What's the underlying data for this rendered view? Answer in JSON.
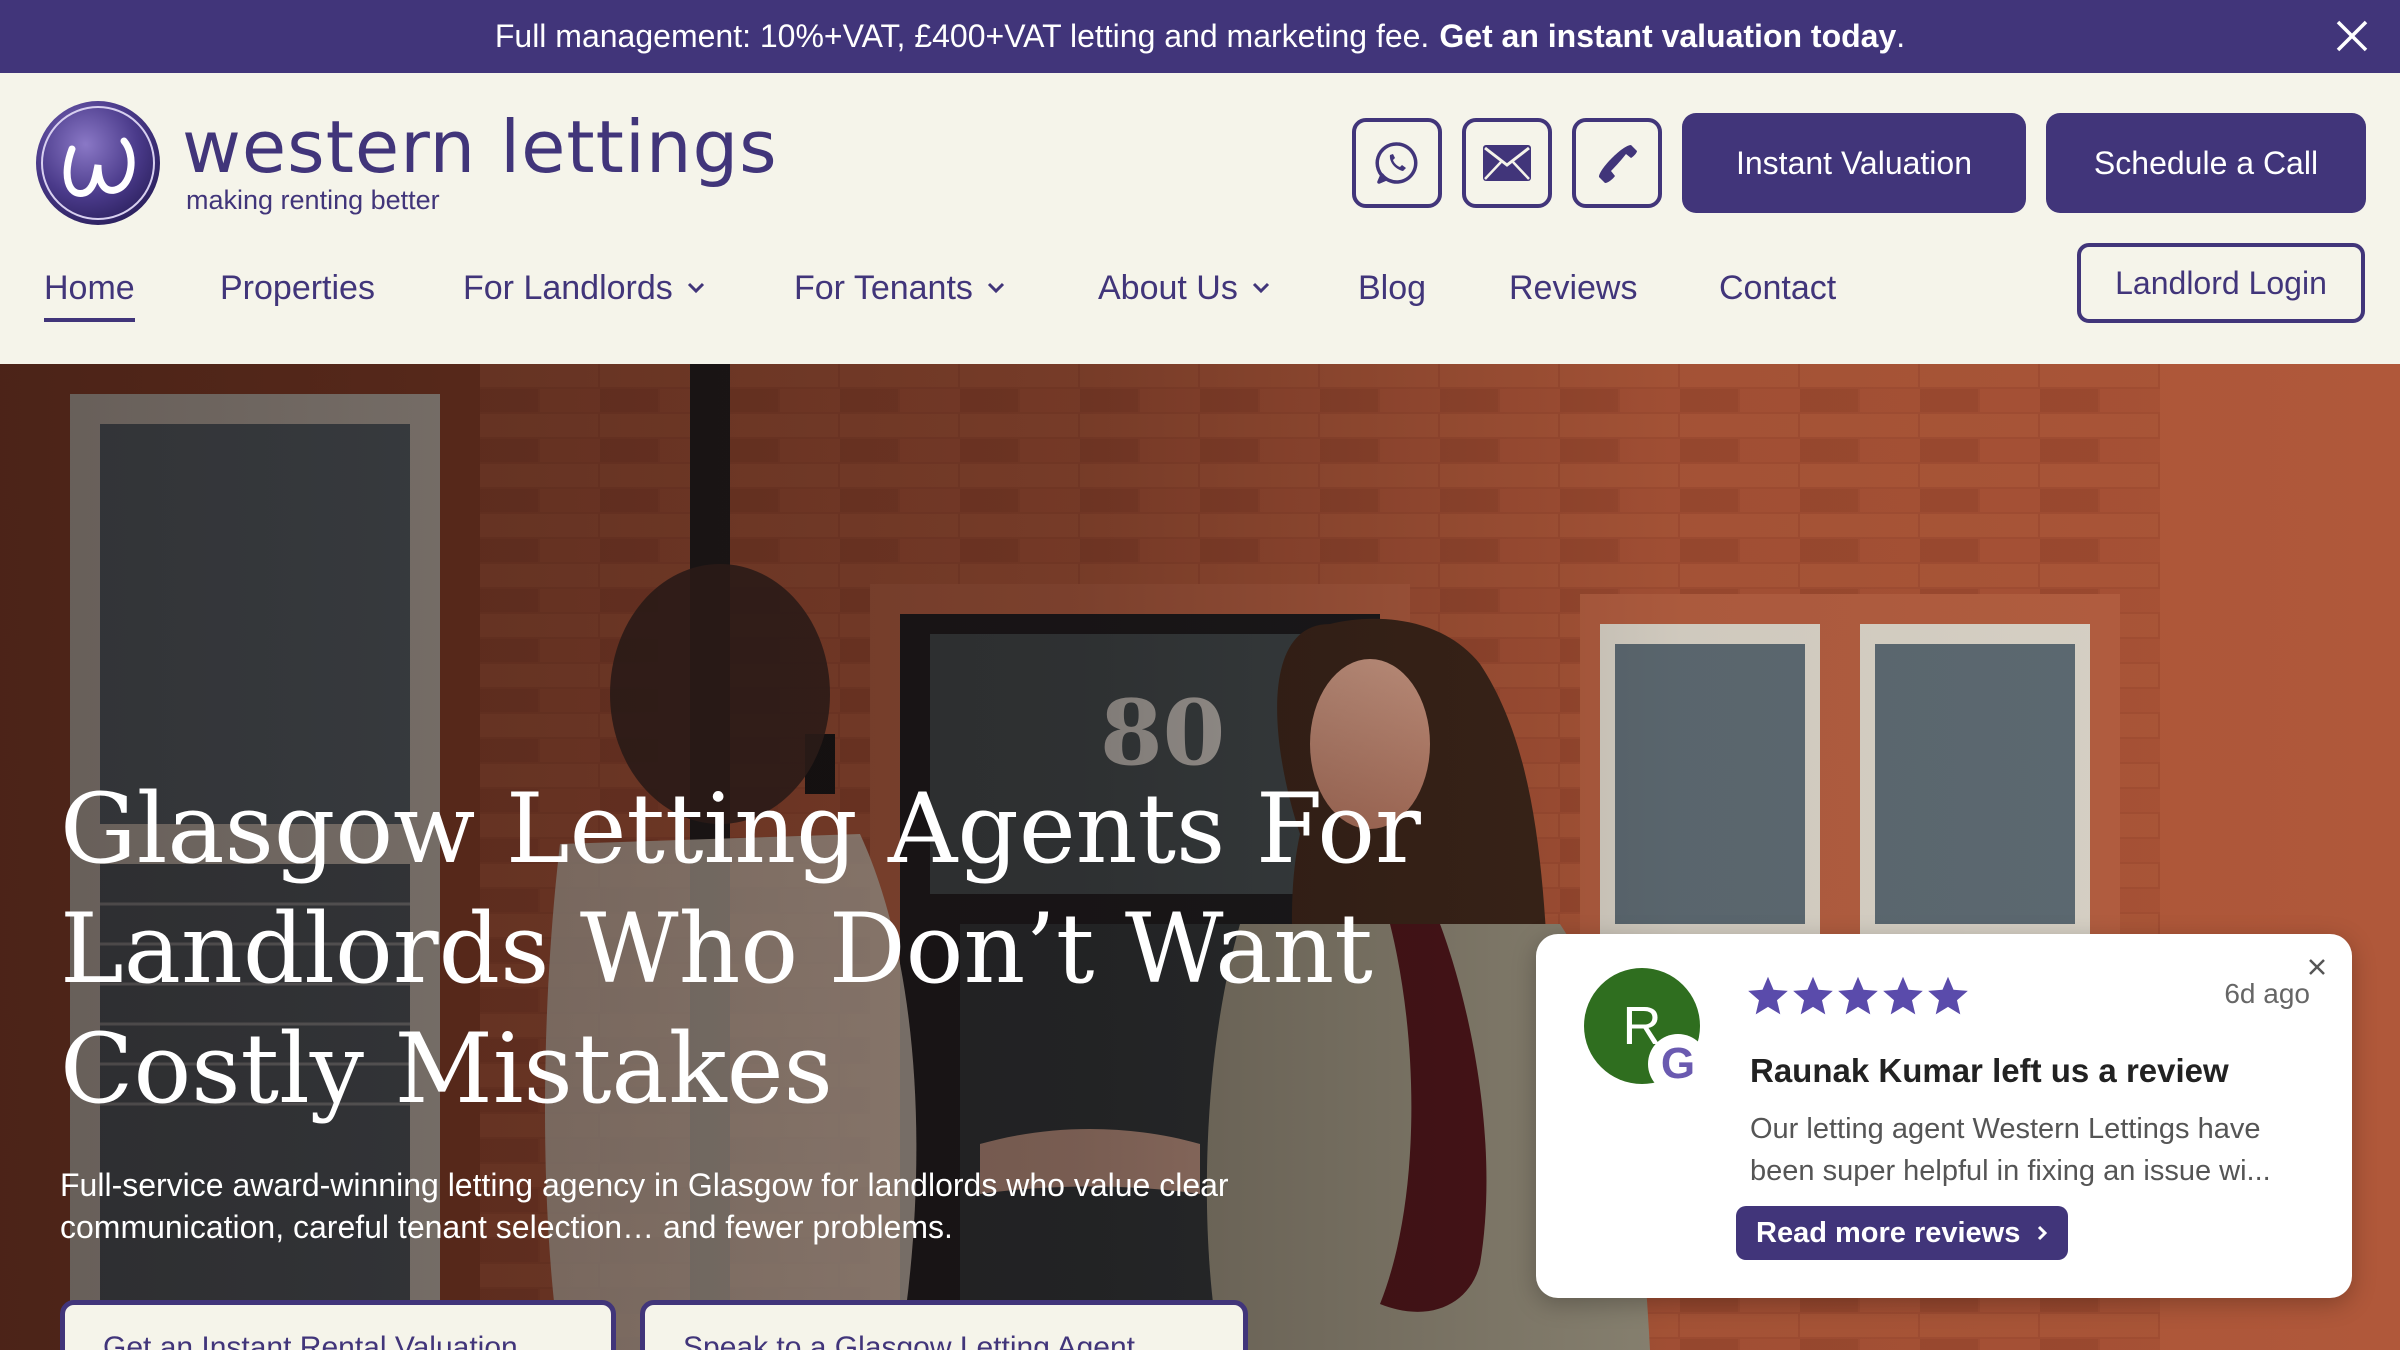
{
  "announcement": {
    "text": "Full management: 10%+VAT, £400+VAT letting and marketing fee.",
    "cta": "Get an instant valuation today",
    "after": "."
  },
  "brand": {
    "name": "western lettings",
    "tagline": "making renting better",
    "color": "#41357a"
  },
  "header": {
    "icons": [
      "whatsapp-icon",
      "mail-icon",
      "phone-icon"
    ],
    "valuation_label": "Instant Valuation",
    "call_label": "Schedule a Call",
    "login_label": "Landlord Login"
  },
  "nav": {
    "items": [
      {
        "label": "Home",
        "active": true
      },
      {
        "label": "Properties"
      },
      {
        "label": "For Landlords",
        "dropdown": true
      },
      {
        "label": "For Tenants",
        "dropdown": true
      },
      {
        "label": "About Us",
        "dropdown": true
      },
      {
        "label": "Blog"
      },
      {
        "label": "Reviews"
      },
      {
        "label": "Contact"
      }
    ]
  },
  "hero": {
    "title": "Glasgow Letting Agents For Landlords Who Don’t Want Costly Mistakes",
    "subtitle": "Full-service award-winning letting agency in Glasgow for landlords who value clear communication, careful tenant selection… and fewer problems.",
    "door_number": "80",
    "buttons": [
      "Get an Instant Rental Valuation",
      "Speak to a Glasgow Letting Agent"
    ]
  },
  "review": {
    "avatar_initial": "R",
    "badge_letter": "G",
    "stars": 5,
    "time_ago": "6d ago",
    "heading": "Raunak Kumar left us a review",
    "text": "Our letting agent Western Lettings have been super helpful in fixing an issue wi...",
    "more_label": "Read more reviews",
    "star_color": "#5a4bab",
    "avatar_color": "#2f6e1f"
  }
}
